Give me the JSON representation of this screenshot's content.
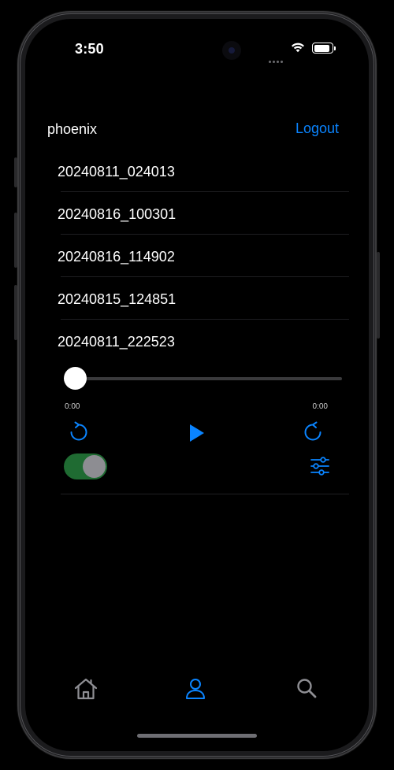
{
  "status_bar": {
    "time": "3:50"
  },
  "header": {
    "username": "phoenix",
    "logout_label": "Logout"
  },
  "recordings": [
    {
      "name": "20240811_024013"
    },
    {
      "name": "20240816_100301"
    },
    {
      "name": "20240816_114902"
    },
    {
      "name": "20240815_124851"
    },
    {
      "name": "20240811_222523"
    }
  ],
  "player": {
    "current_time": "0:00",
    "duration": "0:00",
    "progress": 0,
    "toggle_on": true,
    "icons": {
      "rewind": "rewind-icon",
      "play": "play-icon",
      "forward": "forward-icon",
      "settings": "sliders-icon"
    }
  },
  "tab_bar": {
    "tabs": [
      {
        "icon": "home-icon",
        "selected": false
      },
      {
        "icon": "person-icon",
        "selected": true
      },
      {
        "icon": "search-icon",
        "selected": false
      }
    ]
  },
  "colors": {
    "accent": "#0a84ff",
    "background": "#000000",
    "toggle_track": "#1f6b32",
    "tab_inactive": "#8e8e93"
  }
}
